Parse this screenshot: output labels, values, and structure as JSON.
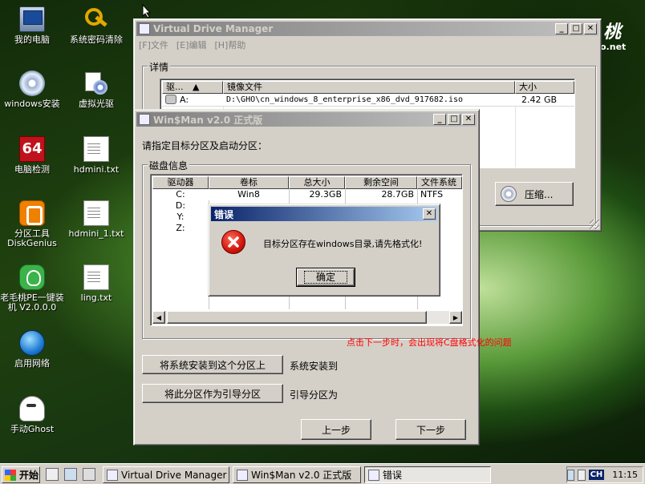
{
  "desktop": {
    "icons": [
      {
        "label": "我的电脑",
        "icon": "computer-icon"
      },
      {
        "label": "系统密码清除",
        "icon": "key-icon"
      },
      {
        "label": "windows安装",
        "icon": "cd-installer-icon"
      },
      {
        "label": "虚拟光驱",
        "icon": "virtual-drive-icon"
      },
      {
        "label": "电脑检测",
        "icon": "aida64-icon"
      },
      {
        "label": "hdmini.txt",
        "icon": "text-file-icon"
      },
      {
        "label": "分区工具DiskGenius",
        "icon": "diskgenius-icon"
      },
      {
        "label": "hdmini_1.txt",
        "icon": "text-file-icon"
      },
      {
        "label": "老毛桃PE一键装机 V2.0.0.0",
        "icon": "peach-installer-icon"
      },
      {
        "label": "ling.txt",
        "icon": "text-file-icon"
      },
      {
        "label": "启用网络",
        "icon": "network-globe-icon"
      },
      {
        "label": "手动Ghost",
        "icon": "ghost-icon"
      }
    ],
    "watermark_text": "桃",
    "watermark_sub": "o.net",
    "annotation": "点击下一步时，会出现将C盘格式化的问题",
    "annotation_color": "#ff0000"
  },
  "vdm": {
    "title": "Virtual Drive Manager",
    "menu": [
      "[F]文件",
      "[E]编辑",
      "[H]帮助"
    ],
    "group_label": "详情",
    "columns": [
      "驱...",
      "镜像文件",
      "大小"
    ],
    "rows": [
      {
        "drive": "A:",
        "image": "D:\\GHO\\cn_windows_8_enterprise_x86_dvd_917682.iso",
        "size": "2.42 GB"
      }
    ],
    "compress_label": "压缩..."
  },
  "winsman": {
    "title": "Win$Man v2.0 正式版",
    "prompt": "请指定目标分区及启动分区：",
    "group_label": "磁盘信息",
    "columns": [
      "驱动器",
      "卷标",
      "总大小",
      "剩余空间",
      "文件系统"
    ],
    "rows": [
      {
        "drive": "C:",
        "label": "Win8",
        "total": "29.3GB",
        "free": "28.7GB",
        "fs": "NTFS"
      },
      {
        "drive": "D:",
        "label": "",
        "total": "",
        "free": "",
        "fs": ""
      },
      {
        "drive": "Y:",
        "label": "",
        "total": "",
        "free": "",
        "fs": ""
      },
      {
        "drive": "Z:",
        "label": "",
        "total": "",
        "free": "",
        "fs": ""
      }
    ],
    "install_button": "将系统安装到这个分区上",
    "install_target_label": "系统安装到",
    "boot_button": "将此分区作为引导分区",
    "boot_target_label": "引导分区为",
    "prev_button": "上一步",
    "next_button": "下一步"
  },
  "error_dialog": {
    "title": "错误",
    "message": "目标分区存在windows目录,请先格式化!",
    "ok_button": "确定",
    "icon": "error-icon"
  },
  "taskbar": {
    "start_label": "开始",
    "tasks": [
      "Virtual Drive Manager",
      "Win$Man v2.0 正式版",
      "错误"
    ],
    "ime": "CH",
    "clock": "11:15"
  }
}
